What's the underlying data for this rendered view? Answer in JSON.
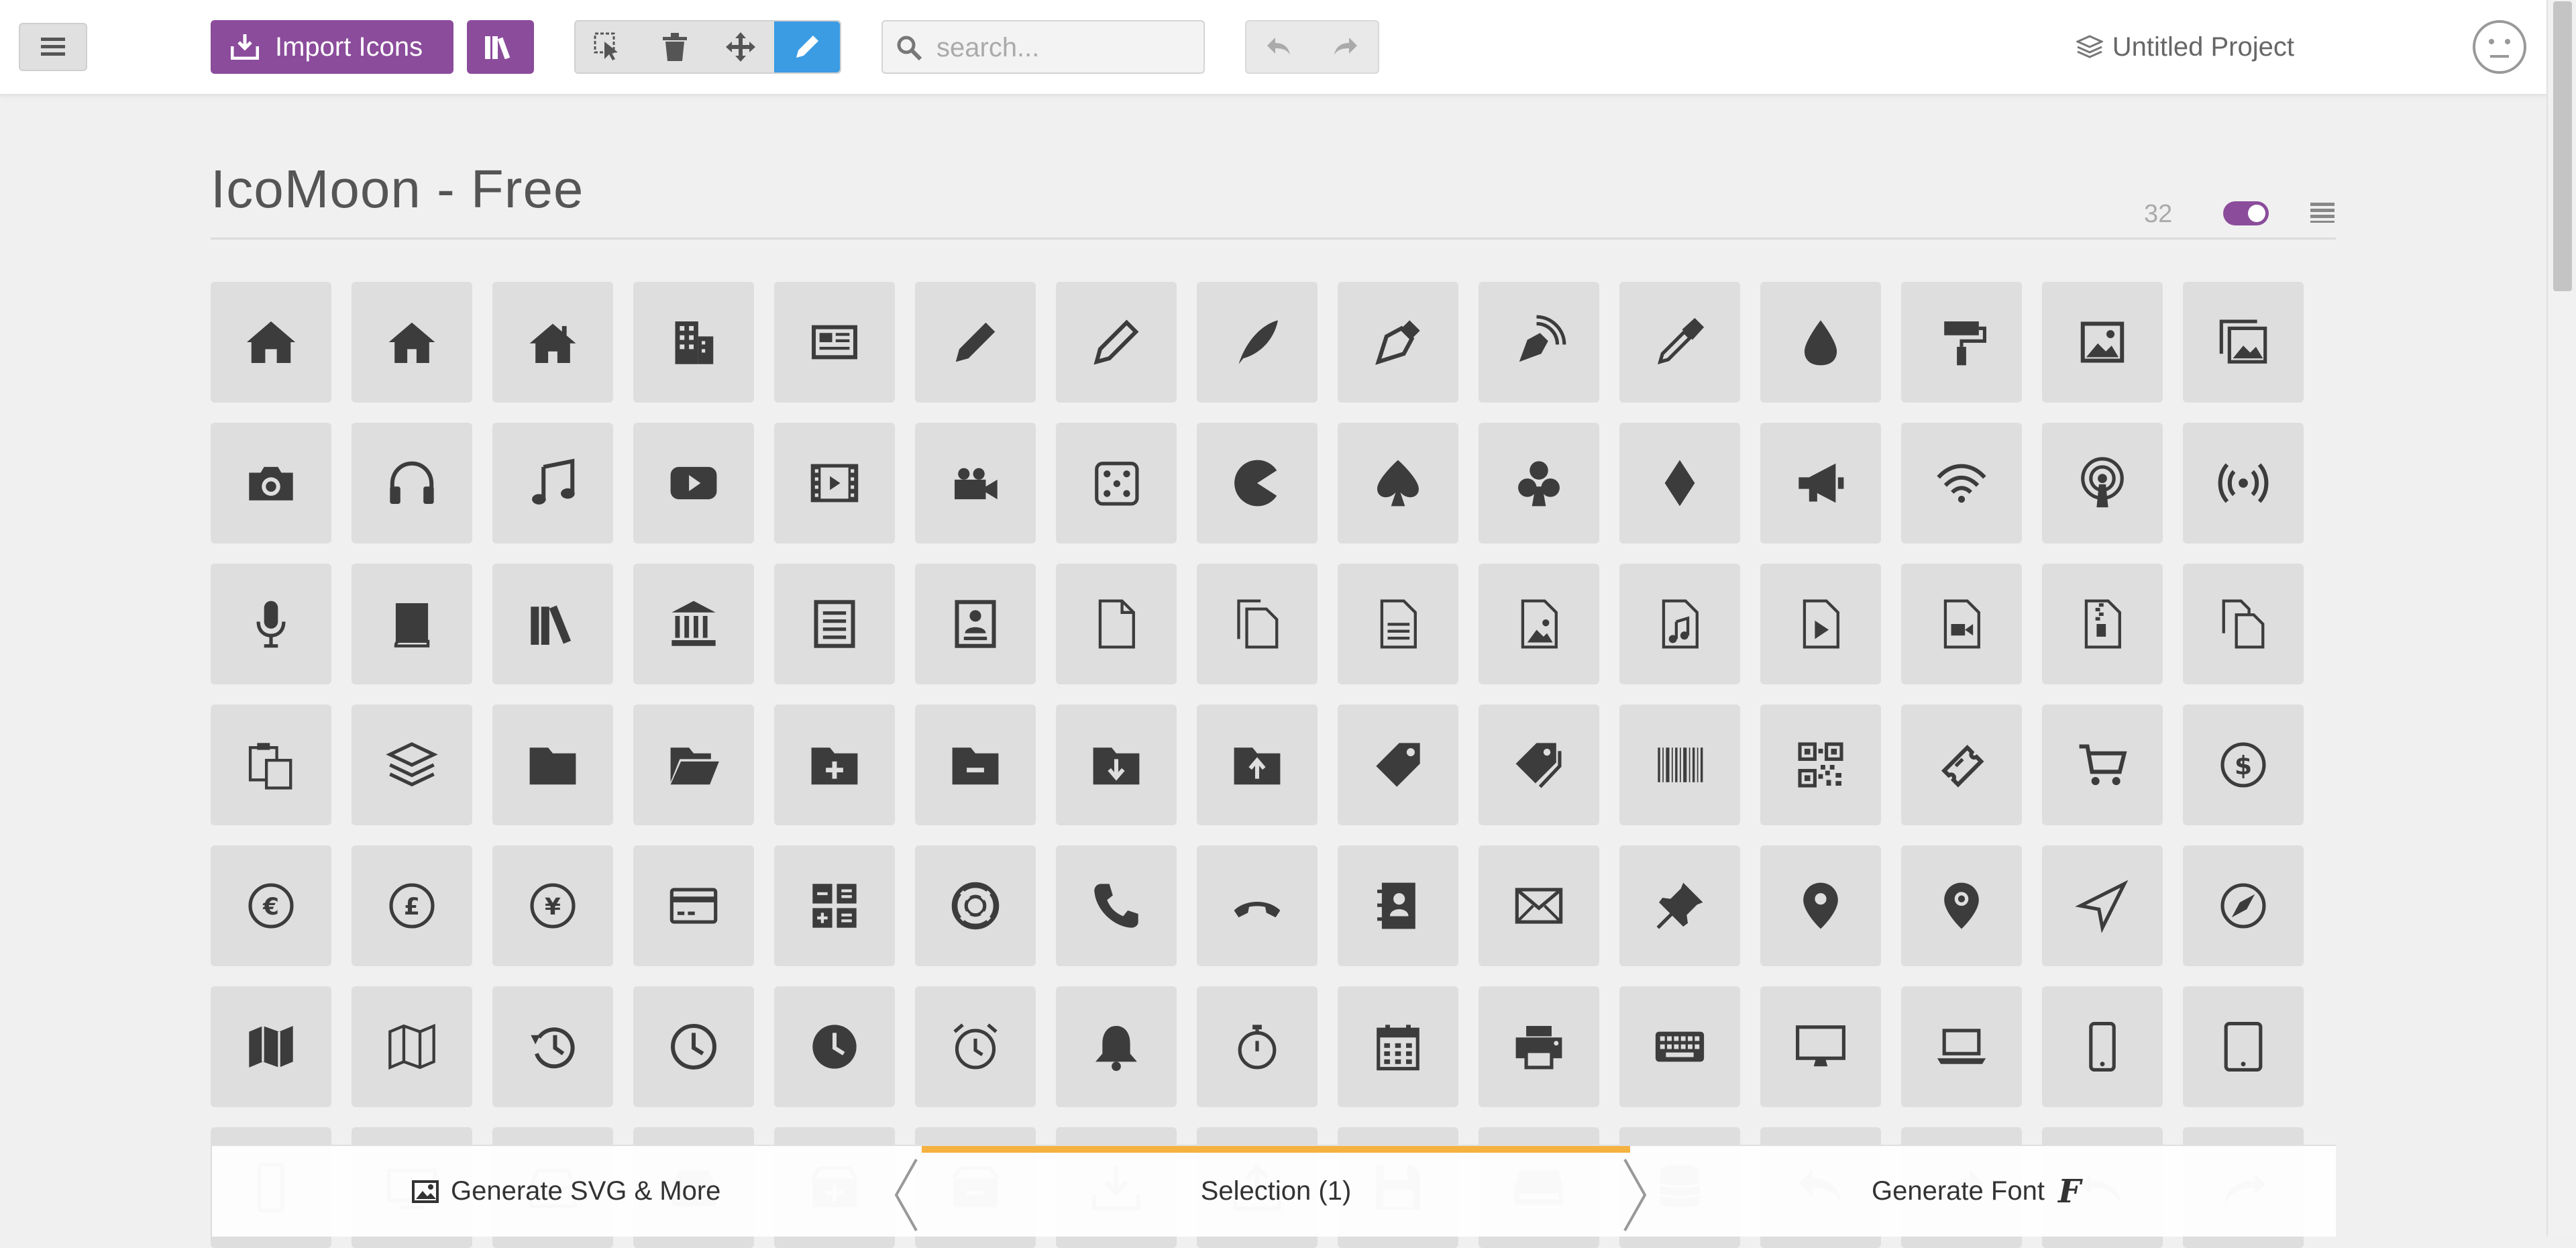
{
  "toolbar": {
    "import_label": "Import Icons",
    "search_placeholder": "search...",
    "project_name": "Untitled Project"
  },
  "icon_set": {
    "title": "IcoMoon - Free",
    "count": "32",
    "icons": [
      "home-icon",
      "home2-icon",
      "home3-icon",
      "office-icon",
      "newspaper-icon",
      "pencil-icon",
      "pencil2-icon",
      "quill-icon",
      "pen-icon",
      "blog-icon",
      "eyedropper-icon",
      "droplet-icon",
      "paint-format-icon",
      "image-icon",
      "images-icon",
      "camera-icon",
      "headphones-icon",
      "music-icon",
      "play-icon",
      "film-icon",
      "video-camera-icon",
      "dice-icon",
      "pacman-icon",
      "spades-icon",
      "clubs-icon",
      "diamonds-icon",
      "bullhorn-icon",
      "connection-icon",
      "podcast-icon",
      "feed-icon",
      "mic-icon",
      "book-icon",
      "books-icon",
      "library-icon",
      "file-text-icon",
      "profile-icon",
      "file-empty-icon",
      "files-empty-icon",
      "file-text2-icon",
      "file-picture-icon",
      "file-music-icon",
      "file-play-icon",
      "file-video-icon",
      "file-zip-icon",
      "copy-icon",
      "paste-icon",
      "stack-icon",
      "folder-icon",
      "folder-open-icon",
      "folder-plus-icon",
      "folder-minus-icon",
      "folder-download-icon",
      "folder-upload-icon",
      "price-tag-icon",
      "price-tags-icon",
      "barcode-icon",
      "qrcode-icon",
      "ticket-icon",
      "cart-icon",
      "coin-dollar-icon",
      "coin-euro-icon",
      "coin-pound-icon",
      "coin-yen-icon",
      "credit-card-icon",
      "calculator-icon",
      "lifebuoy-icon",
      "phone-icon",
      "phone-hang-up-icon",
      "address-book-icon",
      "envelop-icon",
      "pushpin-icon",
      "location-icon",
      "location2-icon",
      "compass-icon",
      "compass2-icon",
      "map-icon",
      "map2-icon",
      "history-icon",
      "clock-icon",
      "clock2-icon",
      "alarm-icon",
      "bell-icon",
      "stopwatch-icon",
      "calendar-icon",
      "printer-icon",
      "keyboard-icon",
      "display-icon",
      "laptop-icon",
      "mobile-icon",
      "tablet-icon",
      "mobile2-icon",
      "tv-icon",
      "drawer-icon",
      "drawer2-icon",
      "box-add-icon",
      "box-remove-icon",
      "download-icon",
      "upload-icon",
      "floppy-disk-icon",
      "drive-icon",
      "database-icon",
      "undo-icon",
      "redo-icon",
      "undo2-icon",
      "redo2-icon"
    ]
  },
  "footer": {
    "generate_svg_label": "Generate SVG & More",
    "selection_label": "Selection (1)",
    "generate_font_label": "Generate Font",
    "font_glyph": "F"
  },
  "colors": {
    "accent_purple": "#8b4c9b",
    "tool_active_blue": "#3b9be3",
    "selection_orange": "#f5b240",
    "icon_tile": "#dedede",
    "icon_glyph": "#3c3c3c"
  }
}
